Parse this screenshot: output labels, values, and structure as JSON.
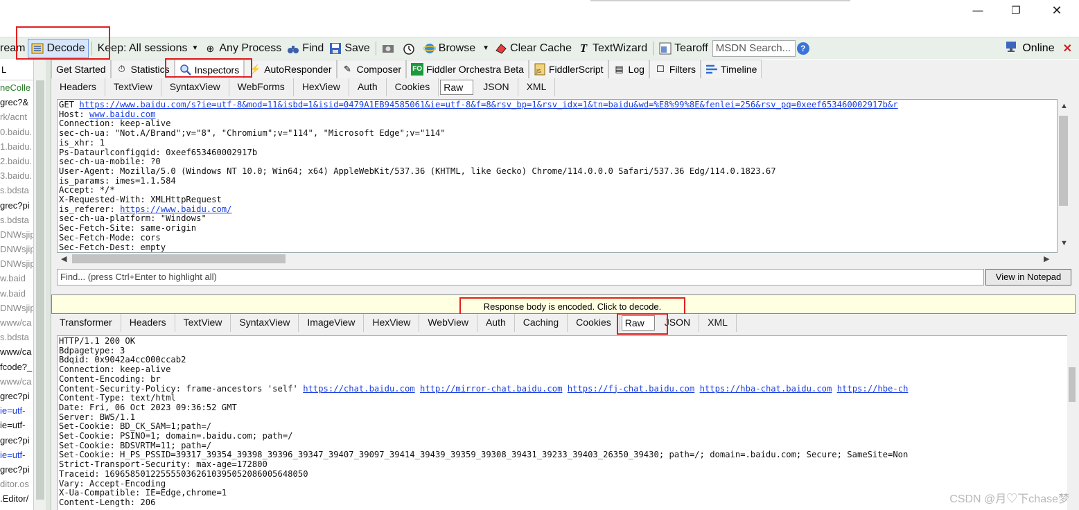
{
  "window": {
    "minimize": "—",
    "maximize": "❐",
    "close": "✕"
  },
  "toolbar": {
    "stream_label": "ream",
    "decode_label": "Decode",
    "keep_label": "Keep: All sessions",
    "process_label": "Any Process",
    "find_label": "Find",
    "save_label": "Save",
    "browse_label": "Browse",
    "clear_cache_label": "Clear Cache",
    "textwizard_label": "TextWizard",
    "tearoff_label": "Tearoff",
    "msdn_placeholder": "MSDN Search...",
    "online_label": "Online"
  },
  "sessions": {
    "header": "L",
    "rows": [
      {
        "text": "neColle",
        "color": "#2a7a2a"
      },
      {
        "text": "grec?&",
        "color": "#111111"
      },
      {
        "text": "rk/acnt",
        "color": "#8a8a8a"
      },
      {
        "text": "0.baidu.",
        "color": "#8a8a8a"
      },
      {
        "text": "1.baidu.",
        "color": "#8a8a8a"
      },
      {
        "text": "2.baidu.",
        "color": "#8a8a8a"
      },
      {
        "text": "3.baidu.",
        "color": "#8a8a8a"
      },
      {
        "text": "s.bdsta",
        "color": "#8a8a8a"
      },
      {
        "text": "grec?pi",
        "color": "#111111"
      },
      {
        "text": "s.bdsta",
        "color": "#8a8a8a"
      },
      {
        "text": "DNWsjip",
        "color": "#8a8a8a"
      },
      {
        "text": "DNWsjip",
        "color": "#8a8a8a"
      },
      {
        "text": "DNWsjip",
        "color": "#8a8a8a"
      },
      {
        "text": "w.baid",
        "color": "#8a8a8a"
      },
      {
        "text": "w.baid",
        "color": "#8a8a8a"
      },
      {
        "text": "DNWsjip",
        "color": "#8a8a8a"
      },
      {
        "text": "www/ca",
        "color": "#8a8a8a"
      },
      {
        "text": "s.bdsta",
        "color": "#8a8a8a"
      },
      {
        "text": "www/ca",
        "color": "#111111"
      },
      {
        "text": "fcode?_",
        "color": "#111111"
      },
      {
        "text": "www/ca",
        "color": "#8a8a8a"
      },
      {
        "text": "grec?pi",
        "color": "#111111"
      },
      {
        "text": "ie=utf-",
        "color": "#1a3ee0"
      },
      {
        "text": "ie=utf-",
        "color": "#111111"
      },
      {
        "text": "grec?pi",
        "color": "#111111"
      },
      {
        "text": "ie=utf-",
        "color": "#1a3ee0"
      },
      {
        "text": "grec?pi",
        "color": "#111111"
      },
      {
        "text": "ditor.os",
        "color": "#8a8a8a"
      },
      {
        "text": ".Editor/",
        "color": "#111111"
      }
    ]
  },
  "main_tabs": {
    "get_started": "Get Started",
    "statistics": "Statistics",
    "inspectors": "Inspectors",
    "autoresponder": "AutoResponder",
    "composer": "Composer",
    "orchestra": "Fiddler Orchestra Beta",
    "fiddlerscript": "FiddlerScript",
    "log": "Log",
    "filters": "Filters",
    "timeline": "Timeline"
  },
  "request_tabs": [
    "Headers",
    "TextView",
    "SyntaxView",
    "WebForms",
    "HexView",
    "Auth",
    "Cookies",
    "Raw",
    "JSON",
    "XML"
  ],
  "request": {
    "line_prefix": "GET ",
    "url": "https://www.baidu.com/s?ie=utf-8&mod=11&isbd=1&isid=0479A1EB94585061&ie=utf-8&f=8&rsv_bp=1&rsv_idx=1&tn=baidu&wd=%E8%99%8E&fenlei=256&rsv_pq=0xeef653460002917b&r",
    "host_label": "Host: ",
    "host": "www.baidu.com",
    "lines_a": "Connection: keep-alive\nsec-ch-ua: \"Not.A/Brand\";v=\"8\", \"Chromium\";v=\"114\", \"Microsoft Edge\";v=\"114\"\nis_xhr: 1\nPs-Dataurlconfigqid: 0xeef653460002917b\nsec-ch-ua-mobile: ?0\nUser-Agent: Mozilla/5.0 (Windows NT 10.0; Win64; x64) AppleWebKit/537.36 (KHTML, like Gecko) Chrome/114.0.0.0 Safari/537.36 Edg/114.0.1823.67\nis_params: imes=1.1.584\nAccept: */*\nX-Requested-With: XMLHttpRequest",
    "referer_label": "is_referer: ",
    "referer": "https://www.baidu.com/",
    "lines_b": "sec-ch-ua-platform: \"Windows\"\nSec-Fetch-Site: same-origin\nSec-Fetch-Mode: cors\nSec-Fetch-Dest: empty"
  },
  "find_placeholder": "Find... (press Ctrl+Enter to highlight all)",
  "view_notepad": "View in Notepad",
  "banner": "Response body is encoded. Click to decode.",
  "response_tabs": [
    "Transformer",
    "Headers",
    "TextView",
    "SyntaxView",
    "ImageView",
    "HexView",
    "WebView",
    "Auth",
    "Caching",
    "Cookies",
    "Raw",
    "JSON",
    "XML"
  ],
  "response": {
    "lines_a": "HTTP/1.1 200 OK\nBdpagetype: 3\nBdqid: 0x9042a4cc000ccab2\nConnection: keep-alive\nContent-Encoding: br",
    "csp_label": "Content-Security-Policy: frame-ancestors 'self' ",
    "csp_links": [
      "https://chat.baidu.com",
      "http://mirror-chat.baidu.com",
      "https://fj-chat.baidu.com",
      "https://hba-chat.baidu.com",
      "https://hbe-ch"
    ],
    "lines_b": "Content-Type: text/html\nDate: Fri, 06 Oct 2023 09:36:52 GMT\nServer: BWS/1.1\nSet-Cookie: BD_CK_SAM=1;path=/\nSet-Cookie: PSINO=1; domain=.baidu.com; path=/\nSet-Cookie: BDSVRTM=11; path=/\nSet-Cookie: H_PS_PSSID=39317_39354_39398_39396_39347_39407_39097_39414_39439_39359_39308_39431_39233_39403_26350_39430; path=/; domain=.baidu.com; Secure; SameSite=Non\nStrict-Transport-Security: max-age=172800\nTraceid: 1696585012255550362610395052086005648050\nVary: Accept-Encoding\nX-Ua-Compatible: IE=Edge,chrome=1\nContent-Length: 206"
  },
  "watermark": "CSDN @月♡下chase梦"
}
